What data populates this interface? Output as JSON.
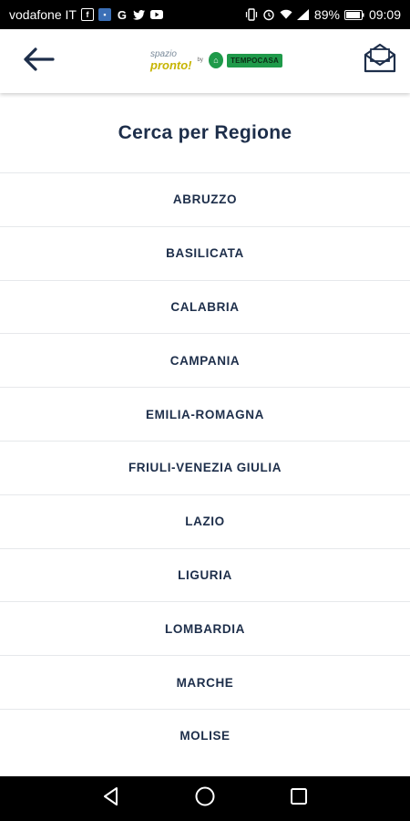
{
  "status_bar": {
    "carrier": "vodafone IT",
    "battery": "89%",
    "time": "09:09",
    "left_icons": [
      "facebook-icon",
      "app-notification-icon",
      "google-icon",
      "twitter-icon",
      "youtube-icon"
    ],
    "right_icons": [
      "vibrate-icon",
      "alarm-icon",
      "wifi-icon",
      "signal-icon",
      "battery-icon"
    ]
  },
  "header": {
    "logo": {
      "spazio": "spazio",
      "pronto": "pronto!",
      "by": "by",
      "brand": "TEMPOCASA"
    },
    "back_icon": "arrow-left-icon",
    "mail_icon": "mail-icon"
  },
  "page": {
    "title": "Cerca per Regione"
  },
  "regions": [
    {
      "label": "ABRUZZO"
    },
    {
      "label": "BASILICATA"
    },
    {
      "label": "CALABRIA"
    },
    {
      "label": "CAMPANIA"
    },
    {
      "label": "EMILIA-ROMAGNA"
    },
    {
      "label": "FRIULI-VENEZIA GIULIA"
    },
    {
      "label": "LAZIO"
    },
    {
      "label": "LIGURIA"
    },
    {
      "label": "LOMBARDIA"
    },
    {
      "label": "MARCHE"
    },
    {
      "label": "MOLISE"
    }
  ],
  "colors": {
    "primary": "#1d2e4a",
    "divider": "#e6e8eb",
    "brand_green": "#1f9a4a",
    "brand_yellow": "#c6b400"
  },
  "navbar": {
    "icons": [
      "back-triangle-icon",
      "home-circle-icon",
      "recents-square-icon"
    ]
  }
}
